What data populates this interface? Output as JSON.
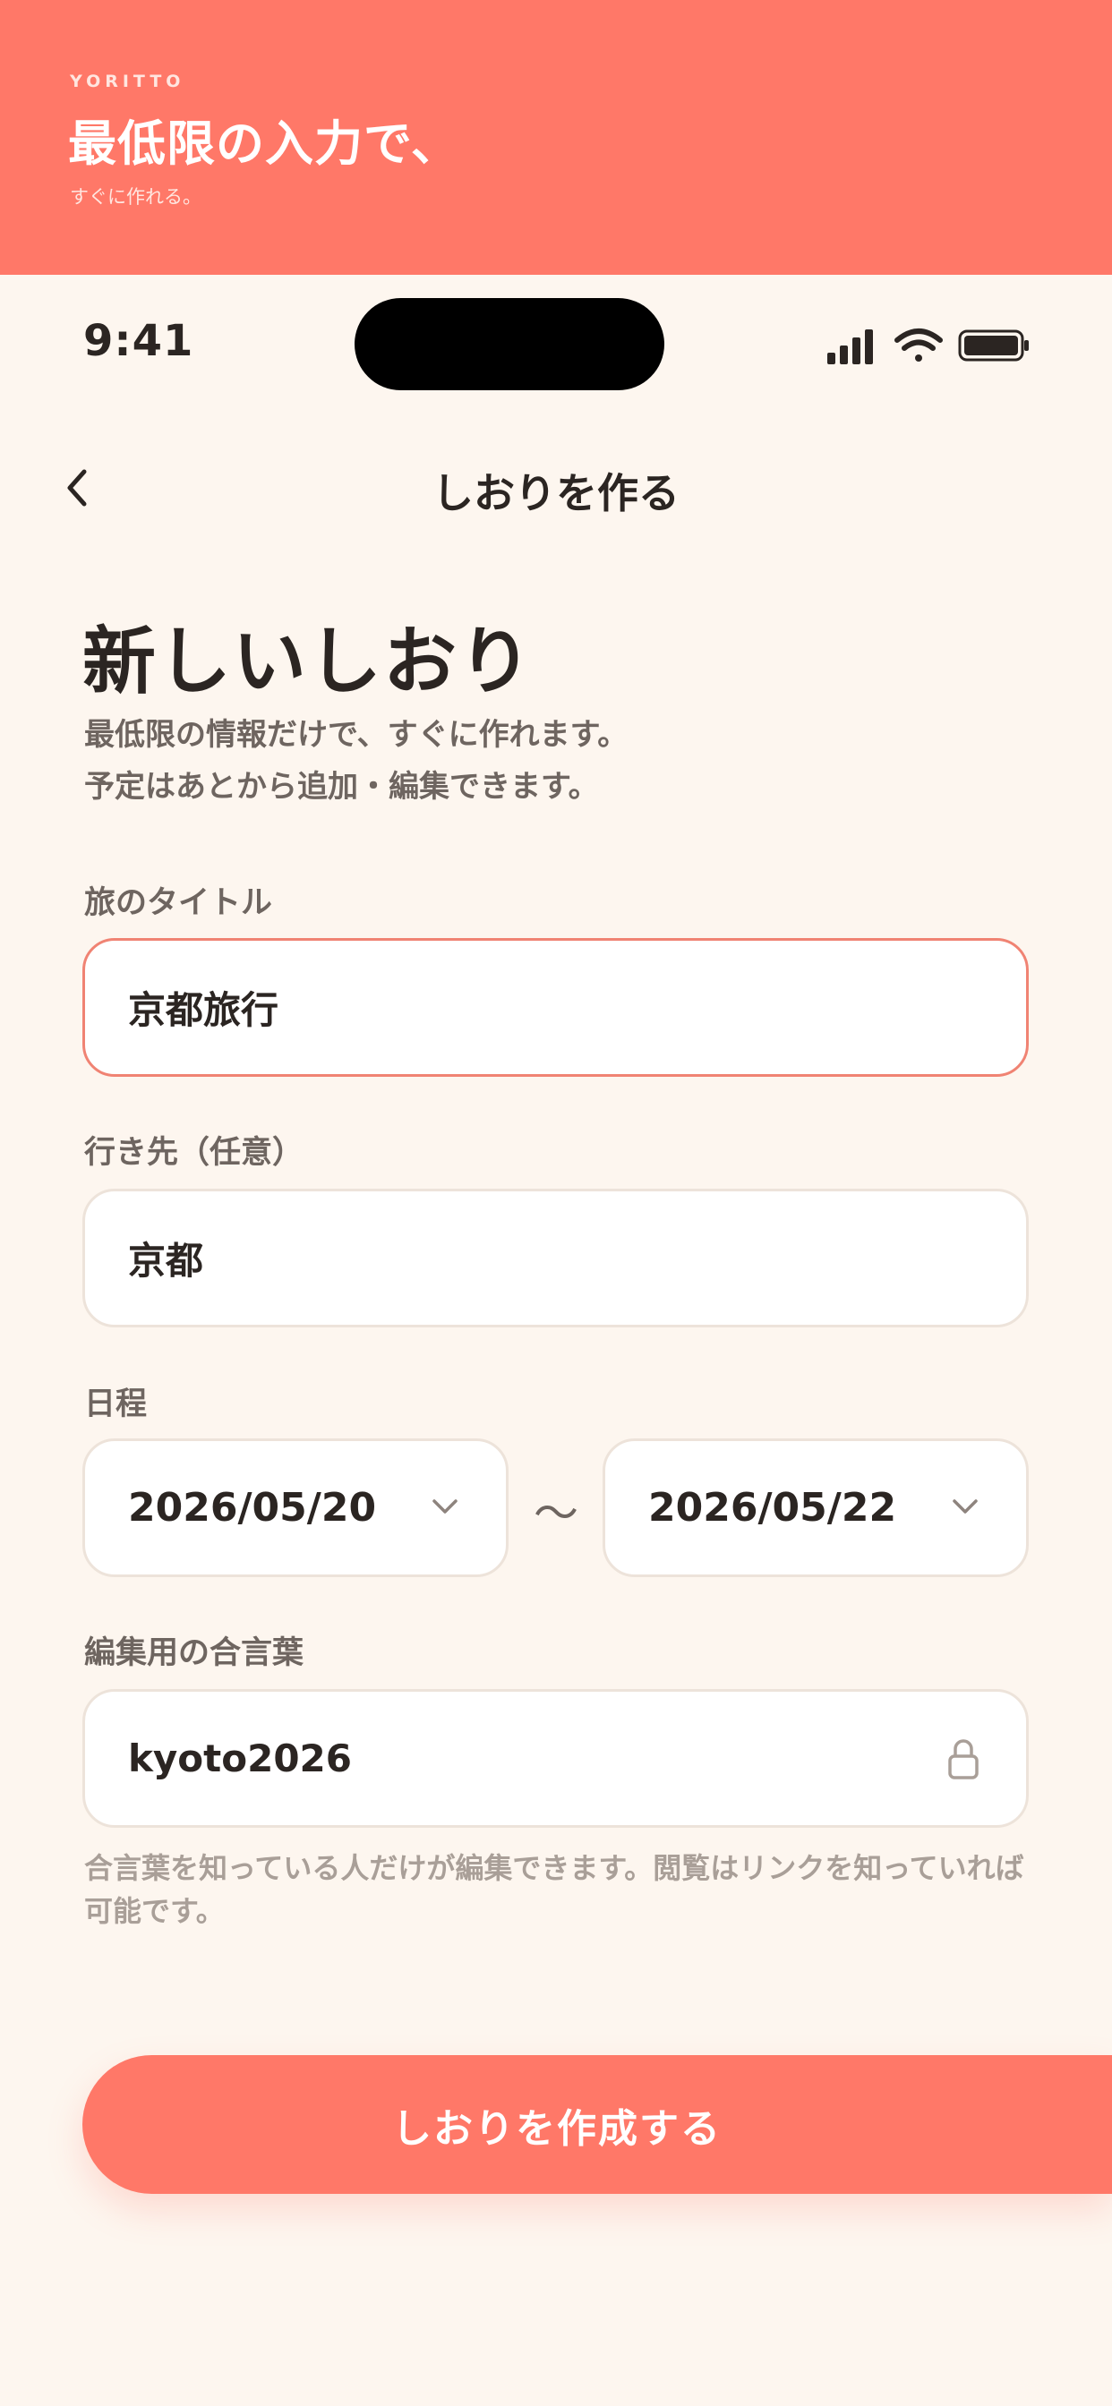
{
  "banner": {
    "brand": "YORITTO",
    "title": "最低限の入力で、",
    "subtitle": "すぐに作れる。"
  },
  "status_bar": {
    "time": "9:41",
    "icons": [
      "cellular-signal-icon",
      "wifi-icon",
      "battery-icon"
    ]
  },
  "nav": {
    "back_icon": "chevron-left-icon",
    "title": "しおりを作る"
  },
  "header": {
    "title": "新しいしおり",
    "description_lines": [
      "最低限の情報だけで、すぐに作れます。",
      "予定はあとから追加・編集できます。"
    ]
  },
  "form": {
    "trip_title": {
      "label": "旅のタイトル",
      "value": "京都旅行",
      "focused": true
    },
    "destination": {
      "label": "行き先（任意）",
      "value": "京都"
    },
    "schedule": {
      "label": "日程",
      "start": "2026/05/20",
      "separator": "〜",
      "end": "2026/05/22",
      "dropdown_icon": "chevron-down-icon"
    },
    "passphrase": {
      "label": "編集用の合言葉",
      "value": "kyoto2026",
      "icon": "lock-icon",
      "help_text": "合言葉を知っている人だけが編集できます。閲覧はリンクを知っていれば可能です。"
    }
  },
  "cta": {
    "label": "しおりを作成する"
  },
  "colors": {
    "accent": "#FF7868",
    "background": "#FDF6EF",
    "focus_border": "#F08373",
    "text_primary": "#2B2522",
    "text_secondary": "#6E6560",
    "text_muted": "#A99F98"
  }
}
